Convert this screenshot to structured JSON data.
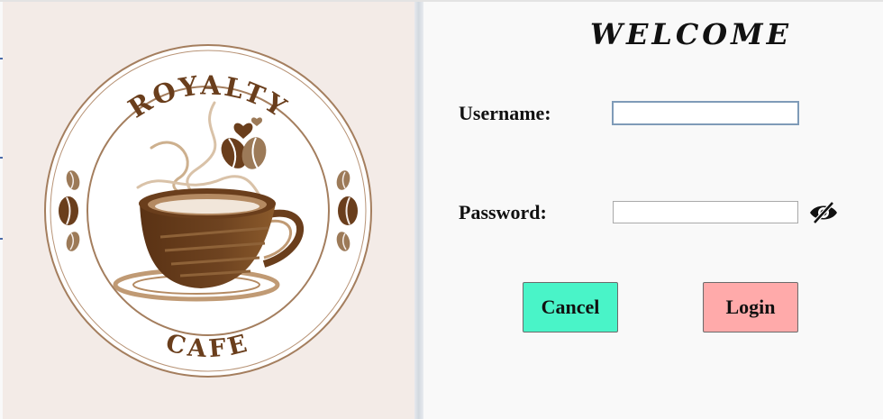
{
  "logo": {
    "top_text": "ROYALTY",
    "bottom_text": "CAFE"
  },
  "login": {
    "title": "WELCOME",
    "username_label": "Username:",
    "username_value": "",
    "password_label": "Password:",
    "password_value": "",
    "cancel_label": "Cancel",
    "login_label": "Login"
  },
  "icons": {
    "password_toggle": "eye-slash-icon"
  },
  "colors": {
    "left_panel_bg": "#f3ebe7",
    "cancel_button": "#49f4c8",
    "login_button": "#ffaaaa",
    "coffee_brown": "#6a3e1c",
    "ring_brown": "#a47e5e"
  }
}
